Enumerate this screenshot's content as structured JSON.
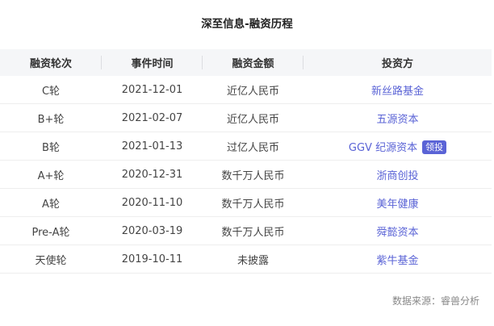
{
  "title": "深至信息-融资历程",
  "table": {
    "headers": [
      "融资轮次",
      "事件时间",
      "融资金额",
      "投资方"
    ],
    "rows": [
      {
        "round": "C轮",
        "date": "2021-12-01",
        "amount": "近亿人民币",
        "investor": "新丝路基金",
        "badge": ""
      },
      {
        "round": "B+轮",
        "date": "2021-02-07",
        "amount": "近亿人民币",
        "investor": "五源资本",
        "badge": ""
      },
      {
        "round": "B轮",
        "date": "2021-01-13",
        "amount": "过亿人民币",
        "investor": "GGV 纪源资本",
        "badge": "领投"
      },
      {
        "round": "A+轮",
        "date": "2020-12-31",
        "amount": "数千万人民币",
        "investor": "浙商创投",
        "badge": ""
      },
      {
        "round": "A轮",
        "date": "2020-11-10",
        "amount": "数千万人民币",
        "investor": "美年健康",
        "badge": ""
      },
      {
        "round": "Pre-A轮",
        "date": "2020-03-19",
        "amount": "数千万人民币",
        "investor": "舜懿资本",
        "badge": ""
      },
      {
        "round": "天使轮",
        "date": "2019-10-11",
        "amount": "未披露",
        "investor": "紫牛基金",
        "badge": ""
      }
    ]
  },
  "source": "数据来源：睿兽分析",
  "colors": {
    "accent": "#5a63d6",
    "header_bg": "#f5f6f8"
  }
}
